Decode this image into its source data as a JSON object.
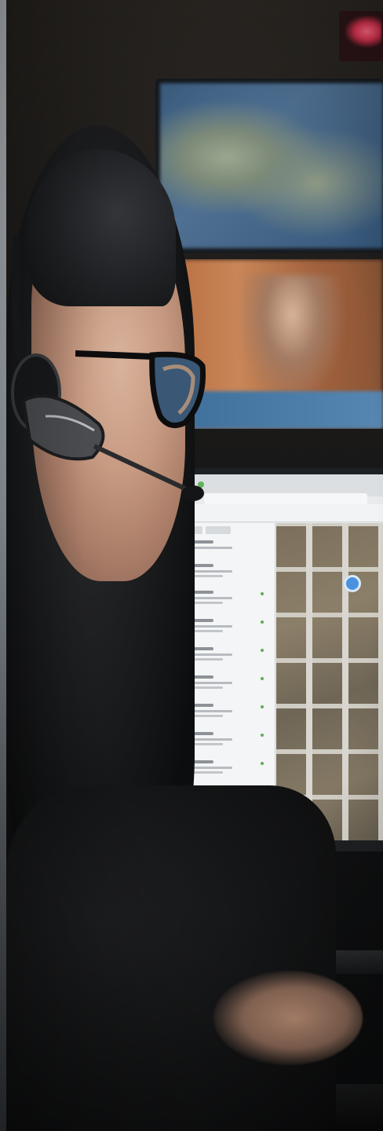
{
  "scene": {
    "colors": {
      "background": "#121314",
      "wall_map_ocean": "#4f7092",
      "news_feed": "#c98658",
      "skin": "#c79a82",
      "hair": "#1a1b1d",
      "map_pin": "#4a92e0",
      "sign_glow": "#ff6a84"
    },
    "icons": [
      "map-pin-icon",
      "headset-icon",
      "glasses-icon"
    ]
  }
}
